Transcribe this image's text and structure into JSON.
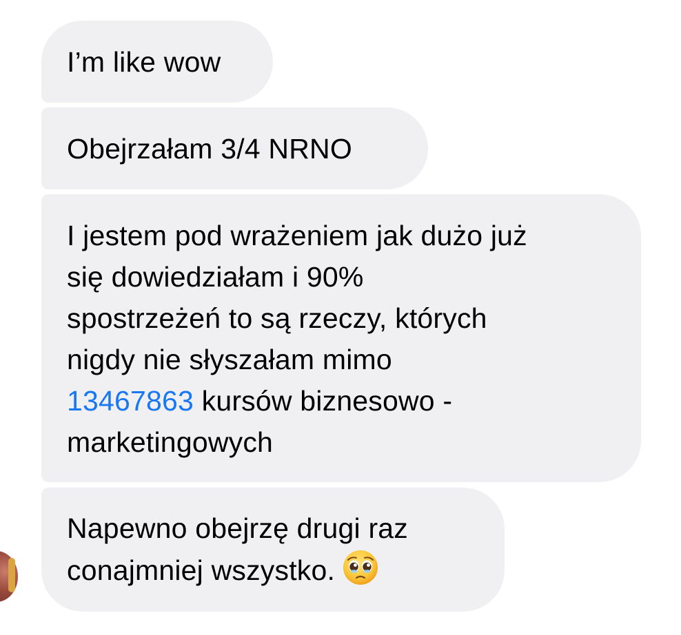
{
  "messages": [
    {
      "text": "I’m like wow"
    },
    {
      "text": "Obejrzałam 3/4 NRNO"
    },
    {
      "lines": [
        "I jestem pod wrażeniem jak dużo już",
        "się dowiedziałam i 90%",
        "spostrzeżeń to są rzeczy, których",
        "nigdy nie słyszałam mimo"
      ],
      "link_text": "13467863",
      "after_link": " kursów biznesowo -",
      "last_line": "marketingowych"
    },
    {
      "lines": [
        "Napewno obejrzę drugi raz",
        "conajmniej wszystko."
      ],
      "emoji": "pleading-face-emoji"
    }
  ],
  "colors": {
    "bubble_background": "#f0f0f2",
    "link": "#1877f2",
    "text": "#000000"
  },
  "avatar": "sender-avatar"
}
